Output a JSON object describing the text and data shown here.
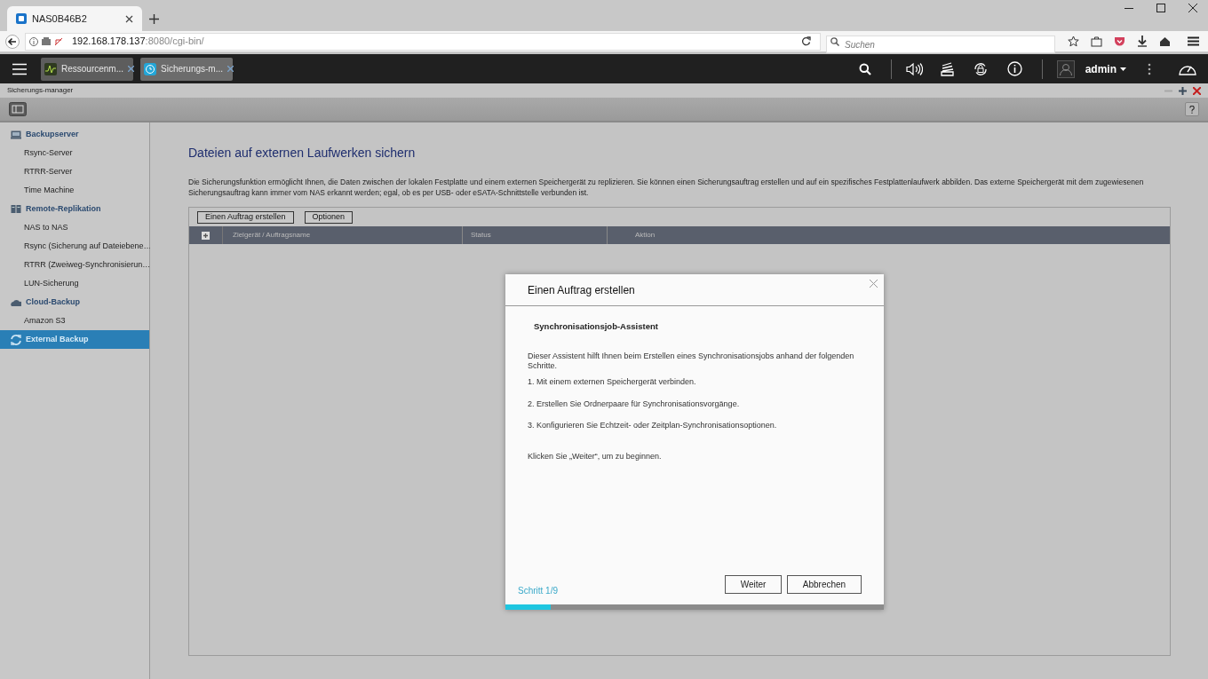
{
  "browser": {
    "tab_title": "NAS0B46B2",
    "url_host": "192.168.178.137",
    "url_rest": ":8080/cgi-bin/",
    "search": {
      "placeholder": "Suchen"
    }
  },
  "taskbar": {
    "apps": [
      {
        "label": "Ressourcenm...",
        "kind": "monitor",
        "selected": false
      },
      {
        "label": "Sicherungs-m...",
        "kind": "backup",
        "selected": true
      }
    ],
    "user": "admin"
  },
  "app": {
    "title": "Sicherungs-manager"
  },
  "sidebar": {
    "items": [
      {
        "label": "Backupserver",
        "kind": "server",
        "selected": false,
        "children": [
          {
            "label": "Rsync-Server",
            "selected": false
          },
          {
            "label": "RTRR-Server",
            "selected": false
          },
          {
            "label": "Time Machine",
            "selected": false
          }
        ]
      },
      {
        "label": "Remote-Replikation",
        "kind": "replication",
        "selected": false,
        "children": [
          {
            "label": "NAS to NAS",
            "selected": false
          },
          {
            "label": "Rsync (Sicherung auf Dateiebene…",
            "selected": false
          },
          {
            "label": "RTRR (Zweiweg-Synchronisierun…",
            "selected": false
          },
          {
            "label": "LUN-Sicherung",
            "selected": false
          }
        ]
      },
      {
        "label": "Cloud-Backup",
        "kind": "cloud",
        "selected": false,
        "children": [
          {
            "label": "Amazon S3",
            "selected": false
          }
        ]
      },
      {
        "label": "External Backup",
        "kind": "sync",
        "selected": true
      }
    ]
  },
  "main": {
    "title": "Dateien auf externen Laufwerken sichern",
    "description": "Die Sicherungsfunktion ermöglicht Ihnen, die Daten zwischen der lokalen Festplatte und einem externen Speichergerät zu replizieren. Sie können einen Sicherungsauftrag erstellen und auf ein spezifisches Festplattenlaufwerk abbilden. Das externe Speichergerät mit dem zugewiesenen Sicherungsauftrag kann immer vom NAS erkannt werden; egal, ob es per USB- oder eSATA-Schnittstelle verbunden ist.",
    "buttons": [
      "Einen Auftrag erstellen",
      "Optionen"
    ],
    "table": {
      "columns": [
        "Zielgerät / Auftragsname",
        "Status",
        "Aktion"
      ]
    }
  },
  "dialog": {
    "title": "Einen Auftrag erstellen",
    "subtitle": "Synchronisationsjob-Assistent",
    "intro": "Dieser Assistent hilft Ihnen beim Erstellen eines Synchronisationsjobs anhand der folgenden Schritte.",
    "steps": [
      "1. Mit einem externen Speichergerät verbinden.",
      "2. Erstellen Sie Ordnerpaare für Synchronisationsvorgänge.",
      "3. Konfigurieren Sie Echtzeit- oder Zeitplan-Synchronisationsoptionen."
    ],
    "outro": "Klicken Sie „Weiter“, um zu beginnen.",
    "step_label": "Schritt 1/9",
    "progress": {
      "level": 0.12
    },
    "buttons": [
      "Weiter",
      "Abbrechen"
    ]
  }
}
